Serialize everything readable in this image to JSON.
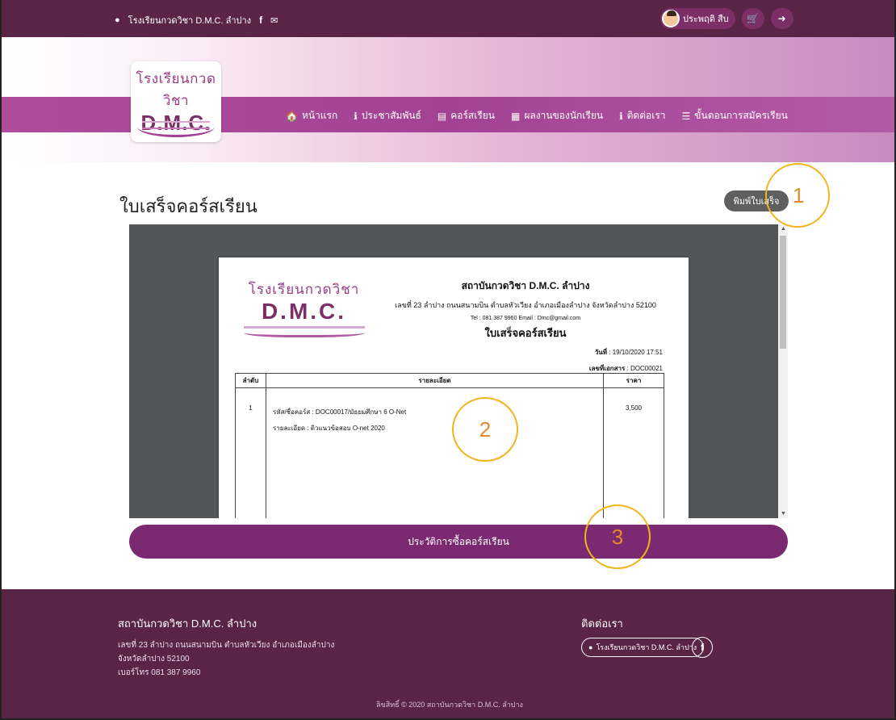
{
  "topbar": {
    "school_link": "โรงเรียนกวดวิชา D.M.C. ลำปาง",
    "facebook_icon": "f",
    "user_name": "ประพฤติ สืบ"
  },
  "logo": {
    "top": "โรงเรียนกวดวิชา",
    "main": "D.M.C."
  },
  "nav": [
    {
      "icon": "home-icon",
      "glyph": "🏠",
      "label": "หน้าแรก"
    },
    {
      "icon": "info-icon",
      "glyph": "ℹ",
      "label": "ประชาสัมพันธ์"
    },
    {
      "icon": "book-icon",
      "glyph": "▤",
      "label": "คอร์สเรียน"
    },
    {
      "icon": "newspaper-icon",
      "glyph": "▦",
      "label": "ผลงานของนักเรียน"
    },
    {
      "icon": "info-icon",
      "glyph": "ℹ",
      "label": "ติดต่อเรา"
    },
    {
      "icon": "list-icon",
      "glyph": "☰",
      "label": "ขั้นตอนการสมัครเรียน"
    }
  ],
  "page": {
    "title": "ใบเสร็จคอร์สเรียน",
    "print_button": "พิมพ์ใบเสร็จ",
    "history_button": "ประวัติการซื้อคอร์สเรียน"
  },
  "receipt": {
    "logo_top": "โรงเรียนกวดวิชา",
    "logo_main": "D.M.C.",
    "org_name": "สถาบันกวดวิชา D.M.C. ลำปาง",
    "address": "เลขที่ 23 ลำปาง ถนนสนามบิน ตำบลหัวเวียง อำเภอเมืองลำปาง จังหวัดลำปาง 52100",
    "contact": "Tel : 081 387 9960 Email : Dmc@gmail.com",
    "doc_title": "ใบเสร็จคอร์สเรียน",
    "date_label": "วันที่",
    "date_value": "19/10/2020 17:51",
    "docno_label": "เลขที่เอกสาร",
    "docno_value": "DOC00021",
    "headers": [
      "ลำดับ",
      "รายละเอียด",
      "ราคา"
    ],
    "rows": [
      {
        "no": "1",
        "line1": "รหัส/ชื่อคอร์ส : DOC00017/มัธยมศึกษา 6 O-Net",
        "line2": "รายละเอียด : ติวแนวข้อสอบ O-net 2020",
        "price": "3,500"
      }
    ]
  },
  "footer": {
    "org_name": "สถาบันกวดวิชา D.M.C. ลำปาง",
    "address1": "เลขที่ 23 ลำปาง ถนนสนามบิน ตำบลหัวเวียง อำเภอเมืองลำปาง",
    "address2": "จังหวัดลำปาง 52100",
    "phone": "เบอร์โทร 081 387 9960",
    "contact_title": "ติดต่อเรา",
    "contact_link": "โรงเรียนกวดวิชา D.M.C. ลำปาง",
    "copyright": "ลิขสิทธิ์ © 2020 สถาบันกวดวิชา D.M.C. ลำปาง"
  },
  "annotations": [
    "1",
    "2",
    "3"
  ],
  "colors": {
    "primary": "#7b2970",
    "topbar": "#5a2447",
    "accent": "#f3b41b"
  }
}
